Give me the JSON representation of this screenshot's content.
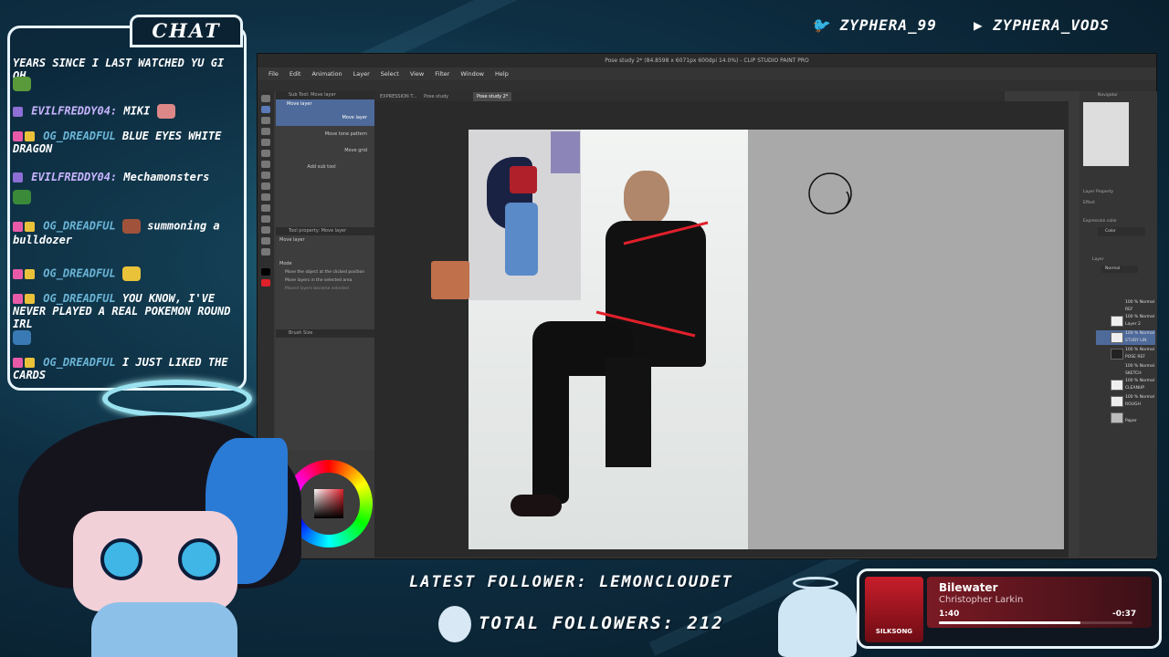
{
  "chat": {
    "title": "CHAT",
    "messages": [
      {
        "user": "",
        "text": "YEARS SINCE I LAST WATCHED YU GI OH"
      },
      {
        "user": "EVILFREDDY04:",
        "text": "MIKI"
      },
      {
        "user": "OG_DREADFUL",
        "text": "BLUE EYES WHITE DRAGON"
      },
      {
        "user": "EVILFREDDY04:",
        "text": "Mechamonsters"
      },
      {
        "user": "OG_DREADFUL",
        "text": "summoning a bulldozer"
      },
      {
        "user": "OG_DREADFUL",
        "text": ""
      },
      {
        "user": "OG_DREADFUL",
        "text": "YOU KNOW, I'VE NEVER PLAYED A REAL POKEMON ROUND IRL"
      },
      {
        "user": "OG_DREADFUL",
        "text": "I JUST LIKED THE CARDS"
      }
    ]
  },
  "socials": {
    "twitter_handle": "ZYPHERA_99",
    "youtube_handle": "ZYPHERA_VODS"
  },
  "app": {
    "title": "Pose study 2* (84.8598 x 6071px 600dpi 14.0%) - CLIP STUDIO PAINT PRO",
    "menu": [
      "File",
      "Edit",
      "Animation",
      "Layer",
      "Select",
      "View",
      "Filter",
      "Window",
      "Help"
    ],
    "doc_tabs": [
      "EXPRESSION T...",
      "Pose study",
      "Pose study 2*"
    ],
    "subtool": {
      "header": "Sub Tool: Move layer",
      "items": [
        "Move layer",
        "Move layer",
        "Move tone pattern",
        "Move grid"
      ],
      "add_label": "Add sub tool"
    },
    "tool_property": {
      "header": "Tool property: Move layer",
      "name": "Move layer",
      "mode_label": "Mode",
      "options": [
        "Move the object at the clicked position",
        "Move layers in the selected area",
        "Moved layers become selected"
      ]
    },
    "brush_size_header": "Brush Size",
    "right": {
      "navigator": "Navigator",
      "layer_property": "Layer Property",
      "effect": "Effect",
      "expression_color": "Expression color",
      "color_value": "Color",
      "layer_header": "Layer",
      "blend_mode": "Normal",
      "layers": [
        {
          "pct": "100 % Normal",
          "name": "REF"
        },
        {
          "pct": "100 % Normal",
          "name": "Layer 2"
        },
        {
          "pct": "100 % Normal",
          "name": "STUDY LIN"
        },
        {
          "pct": "100 % Normal",
          "name": "POSE REF"
        },
        {
          "pct": "100 % Normal",
          "name": "SKETCH"
        },
        {
          "pct": "100 % Normal",
          "name": "CLEANUP"
        },
        {
          "pct": "100 % Normal",
          "name": "ROUGH"
        },
        {
          "pct": "",
          "name": "Paper"
        }
      ]
    }
  },
  "bottom": {
    "latest_follower": "LATEST FOLLOWER: LEMONCLOUDET",
    "total_followers": "TOTAL FOLLOWERS: 212"
  },
  "now_playing": {
    "album_label": "SILKSONG",
    "track": "Bilewater",
    "artist": "Christopher Larkin",
    "elapsed": "1:40",
    "remaining": "-0:37",
    "progress_fraction": 0.73
  },
  "colors": {
    "accent_red": "#e0202a",
    "chat_border": "#e8f4fb"
  }
}
